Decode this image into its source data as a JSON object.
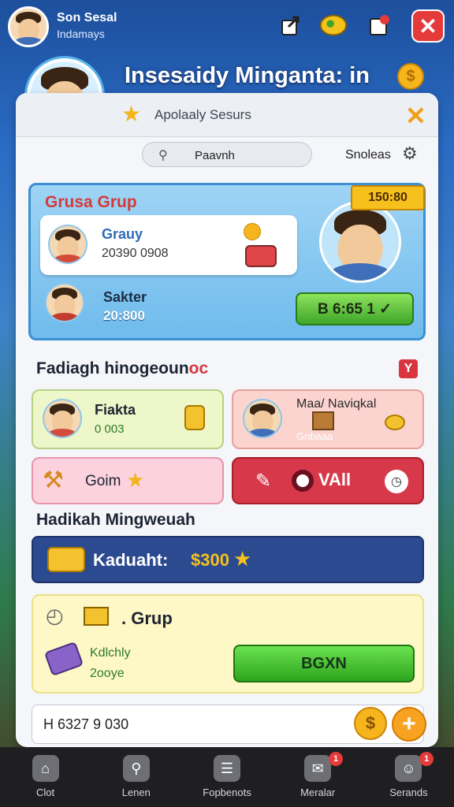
{
  "header": {
    "profile_name": "Son Sesal",
    "profile_sub": "Indamays",
    "icons": [
      "share-icon",
      "chat-icon",
      "mail-icon"
    ],
    "close_glyph": "✕"
  },
  "title": "Insesaidy Minganta: in",
  "title_coin_glyph": "$",
  "panel": {
    "header_title": "Apolaaly Sesurs",
    "close_glyph": "✕",
    "search_text": "Paavnh",
    "sort_label": "Snoleas"
  },
  "group_card": {
    "title": "Grusa Grup",
    "badge": "150:80",
    "member1_name": "Grauy",
    "member1_score": "20390 0908",
    "member2_name": "Sakter",
    "member2_score": "20:800",
    "button_label": "B 6:65 1 ✓"
  },
  "section1": {
    "title_main": "Fadiagh hinogeoun",
    "title_hl": "oc",
    "icon_glyph": "Y"
  },
  "tiles": {
    "a_name": "Fiakta",
    "a_value": "0 003",
    "b_name": "Maa/ Naviqkal",
    "b_value": "Gnbaaa",
    "c_label": "Goim",
    "d_label": "VAll"
  },
  "section2": {
    "title": "Hadikah Mingweuah"
  },
  "reward": {
    "label": "Kaduaht:",
    "amount": "$300"
  },
  "grup_card": {
    "title": ". Grup",
    "line1": "Kdlchly",
    "line2": "2ooye",
    "button_label": "BGXN"
  },
  "chat": {
    "text": "H  6327 9 030",
    "coin_glyph": "$",
    "plus_glyph": "+"
  },
  "nav": [
    {
      "label": "Clot",
      "icon": "home-icon",
      "glyph": "⌂",
      "badge": ""
    },
    {
      "label": "Lenen",
      "icon": "search-icon",
      "glyph": "⚲",
      "badge": ""
    },
    {
      "label": "Fopbenots",
      "icon": "list-icon",
      "glyph": "☰",
      "badge": ""
    },
    {
      "label": "Meralar",
      "icon": "chat-icon",
      "glyph": "✉",
      "badge": "1"
    },
    {
      "label": "Serands",
      "icon": "friends-icon",
      "glyph": "☺",
      "badge": "1"
    }
  ],
  "colors": {
    "accent_green": "#3fa62a",
    "accent_red": "#d93540",
    "accent_gold": "#f6c01d",
    "nav_bg": "#1f1f22"
  }
}
